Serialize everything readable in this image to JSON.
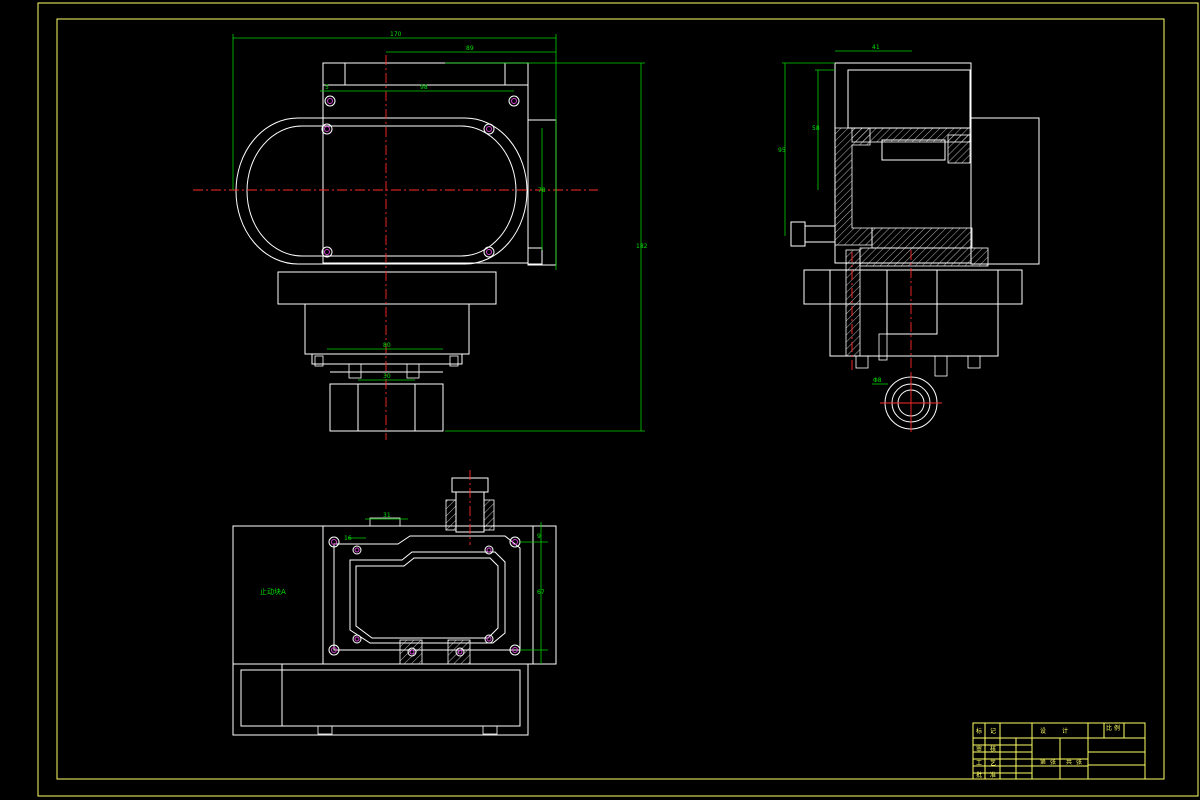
{
  "front_view": {
    "dims": {
      "overall_width": "170",
      "upper_width": "89",
      "hole_spacing": "98",
      "offset": "5",
      "height_right": "78",
      "total_height": "182",
      "bottom_width": "80",
      "bottom_inner": "30"
    }
  },
  "side_view": {
    "dims": {
      "top": "41",
      "inner_h": "58",
      "outer_h": "95"
    },
    "callout": "Φ8"
  },
  "top_view": {
    "dims": {
      "pitch": "31",
      "small": "16",
      "depth": "67",
      "edge": "9"
    },
    "label": "止动块A"
  },
  "title_block": {
    "cells": [
      "标",
      "记",
      "设",
      "计",
      "审",
      "核",
      "工",
      "艺",
      "批",
      "准",
      "比",
      "例",
      "第",
      "张",
      "共",
      "张"
    ]
  }
}
